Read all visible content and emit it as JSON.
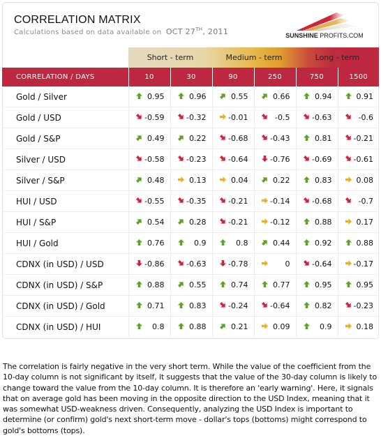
{
  "header": {
    "title": "CORRELATION MATRIX",
    "subtitle_prefix": "Calculations based on data available on",
    "date_main": "OCT 27",
    "date_suffix": "TH",
    "date_year": ", 2011"
  },
  "logo": {
    "text_bold": "SUNSHINE",
    "text_regular": " PROFITS.COM",
    "colors": [
      "#c8283c",
      "#e0a040",
      "#d9d0b0"
    ]
  },
  "terms": {
    "short": "Short - term",
    "medium": "Medium - term",
    "long": "Long - term"
  },
  "table": {
    "label_header": "CORRELATION / DAYS",
    "columns": [
      "10",
      "30",
      "90",
      "250",
      "750",
      "1500"
    ],
    "arrow_colors": {
      "up": "#5fa02a",
      "up-right": "#5fa02a",
      "right": "#e8b030",
      "down-right": "#c8283c",
      "down": "#c8283c"
    },
    "rows": [
      {
        "label": "Gold / Silver",
        "cells": [
          {
            "value": "0.95",
            "trend": "up"
          },
          {
            "value": "0.96",
            "trend": "up"
          },
          {
            "value": "0.55",
            "trend": "up-right"
          },
          {
            "value": "0.66",
            "trend": "up-right"
          },
          {
            "value": "0.94",
            "trend": "up"
          },
          {
            "value": "0.91",
            "trend": "up"
          }
        ]
      },
      {
        "label": "Gold / USD",
        "cells": [
          {
            "value": "-0.59",
            "trend": "down-right"
          },
          {
            "value": "-0.32",
            "trend": "down-right"
          },
          {
            "value": "-0.01",
            "trend": "right"
          },
          {
            "value": "-0.5",
            "trend": "down-right"
          },
          {
            "value": "-0.63",
            "trend": "down-right"
          },
          {
            "value": "-0.6",
            "trend": "down-right"
          }
        ]
      },
      {
        "label": "Gold / S&P",
        "cells": [
          {
            "value": "0.49",
            "trend": "up-right"
          },
          {
            "value": "0.22",
            "trend": "up-right"
          },
          {
            "value": "-0.68",
            "trend": "down-right"
          },
          {
            "value": "-0.43",
            "trend": "down-right"
          },
          {
            "value": "0.81",
            "trend": "up"
          },
          {
            "value": "-0.21",
            "trend": "down-right"
          }
        ]
      },
      {
        "label": "Silver / USD",
        "cells": [
          {
            "value": "-0.58",
            "trend": "down-right"
          },
          {
            "value": "-0.23",
            "trend": "down-right"
          },
          {
            "value": "-0.64",
            "trend": "down-right"
          },
          {
            "value": "-0.76",
            "trend": "down"
          },
          {
            "value": "-0.69",
            "trend": "down-right"
          },
          {
            "value": "-0.61",
            "trend": "down-right"
          }
        ]
      },
      {
        "label": "Silver / S&P",
        "cells": [
          {
            "value": "0.48",
            "trend": "up-right"
          },
          {
            "value": "0.13",
            "trend": "right"
          },
          {
            "value": "0.04",
            "trend": "right"
          },
          {
            "value": "0.22",
            "trend": "up-right"
          },
          {
            "value": "0.83",
            "trend": "up"
          },
          {
            "value": "0.08",
            "trend": "right"
          }
        ]
      },
      {
        "label": "HUI / USD",
        "cells": [
          {
            "value": "-0.55",
            "trend": "down-right"
          },
          {
            "value": "-0.35",
            "trend": "down-right"
          },
          {
            "value": "-0.21",
            "trend": "down-right"
          },
          {
            "value": "-0.14",
            "trend": "right"
          },
          {
            "value": "-0.68",
            "trend": "down-right"
          },
          {
            "value": "-0.7",
            "trend": "down-right"
          }
        ]
      },
      {
        "label": "HUI / S&P",
        "cells": [
          {
            "value": "0.54",
            "trend": "up-right"
          },
          {
            "value": "0.28",
            "trend": "up-right"
          },
          {
            "value": "-0.21",
            "trend": "down-right"
          },
          {
            "value": "-0.12",
            "trend": "right"
          },
          {
            "value": "0.88",
            "trend": "up"
          },
          {
            "value": "0.17",
            "trend": "right"
          }
        ]
      },
      {
        "label": "HUI / Gold",
        "cells": [
          {
            "value": "0.76",
            "trend": "up"
          },
          {
            "value": "0.9",
            "trend": "up"
          },
          {
            "value": "0.8",
            "trend": "up"
          },
          {
            "value": "0.44",
            "trend": "up-right"
          },
          {
            "value": "0.92",
            "trend": "up"
          },
          {
            "value": "0.88",
            "trend": "up"
          }
        ]
      },
      {
        "label": "CDNX (in USD) / USD",
        "cells": [
          {
            "value": "-0.86",
            "trend": "down"
          },
          {
            "value": "-0.63",
            "trend": "down-right"
          },
          {
            "value": "-0.78",
            "trend": "down"
          },
          {
            "value": "0",
            "trend": "right"
          },
          {
            "value": "-0.64",
            "trend": "down-right"
          },
          {
            "value": "-0.17",
            "trend": "right"
          }
        ]
      },
      {
        "label": "CDNX (in USD) / S&P",
        "cells": [
          {
            "value": "0.88",
            "trend": "up"
          },
          {
            "value": "0.55",
            "trend": "up-right"
          },
          {
            "value": "0.74",
            "trend": "up"
          },
          {
            "value": "0.77",
            "trend": "up"
          },
          {
            "value": "0.95",
            "trend": "up"
          },
          {
            "value": "0.95",
            "trend": "up"
          }
        ]
      },
      {
        "label": "CDNX (in USD) / Gold",
        "cells": [
          {
            "value": "0.71",
            "trend": "up"
          },
          {
            "value": "0.83",
            "trend": "up"
          },
          {
            "value": "-0.24",
            "trend": "down-right"
          },
          {
            "value": "-0.64",
            "trend": "down-right"
          },
          {
            "value": "0.82",
            "trend": "up"
          },
          {
            "value": "-0.23",
            "trend": "down-right"
          }
        ]
      },
      {
        "label": "CDNX (in USD) / HUI",
        "cells": [
          {
            "value": "0.8",
            "trend": "up"
          },
          {
            "value": "0.88",
            "trend": "up"
          },
          {
            "value": "0.21",
            "trend": "up-right"
          },
          {
            "value": "0.09",
            "trend": "right"
          },
          {
            "value": "0.9",
            "trend": "up"
          },
          {
            "value": "0.18",
            "trend": "right"
          }
        ]
      }
    ]
  },
  "commentary": "The correlation is fairly negative in the very short term. While the value of the coefficient from the 10-day column is not significant by itself, it suggests that the value of the 30-day column is likely to change toward the value from the 10-day column. It is therefore an 'early warning'. Here, it signals that on average gold has been moving in the opposite direction to the USD Index, meaning that it was somewhat USD-weakness driven. Consequently, analyzing the USD Index is important to determine (or confirm) gold's next short-term move - dollar's tops (bottoms) might correspond to gold's bottoms (tops)."
}
